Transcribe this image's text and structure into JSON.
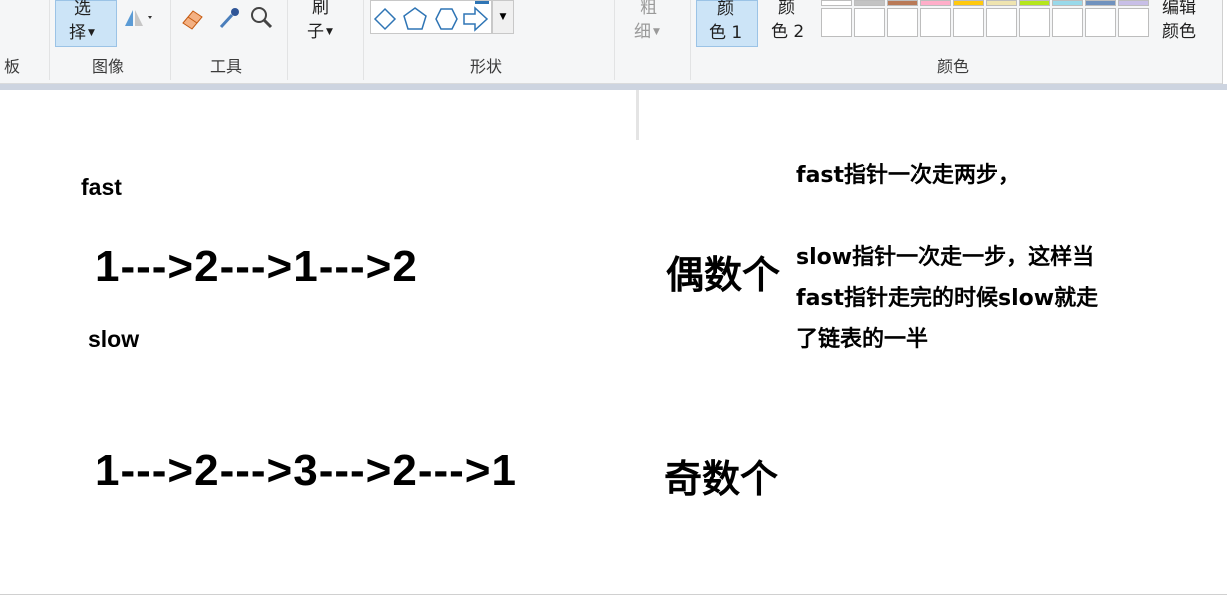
{
  "ribbon": {
    "select_line1": "选",
    "select_line2": "择",
    "brush_line1": "刷",
    "brush_line2": "子",
    "size_line1": "粗",
    "size_line2": "细",
    "color1_line1": "颜",
    "color1_line2": "色 1",
    "color2_line1": "颜",
    "color2_line2": "色 2",
    "edit_line1": "编辑",
    "edit_line2": "颜色",
    "groups": {
      "clipboard": "板",
      "image": "图像",
      "tools": "工具",
      "shapes": "形状",
      "colors": "颜色"
    },
    "palette_top_colors": [
      "#ffffff",
      "#c3c3c3",
      "#b97a57",
      "#ffaec9",
      "#ffc90e",
      "#efe4b0",
      "#b5e61d",
      "#99d9ea",
      "#7092be",
      "#c8bfe7"
    ],
    "accent": "#cce4f7"
  },
  "canvas": {
    "fast_label": "fast",
    "slow_label": "slow",
    "even_sequence": "1--->2--->1--->2",
    "odd_sequence": "1--->2--->3--->2--->1",
    "even_heading": "偶数个",
    "odd_heading": "奇数个",
    "note_line1": "fast指针一次走两步，",
    "note_line2": "slow指针一次走一步，这样当",
    "note_line3": "fast指针走完的时候slow就走",
    "note_line4": "了链表的一半"
  }
}
